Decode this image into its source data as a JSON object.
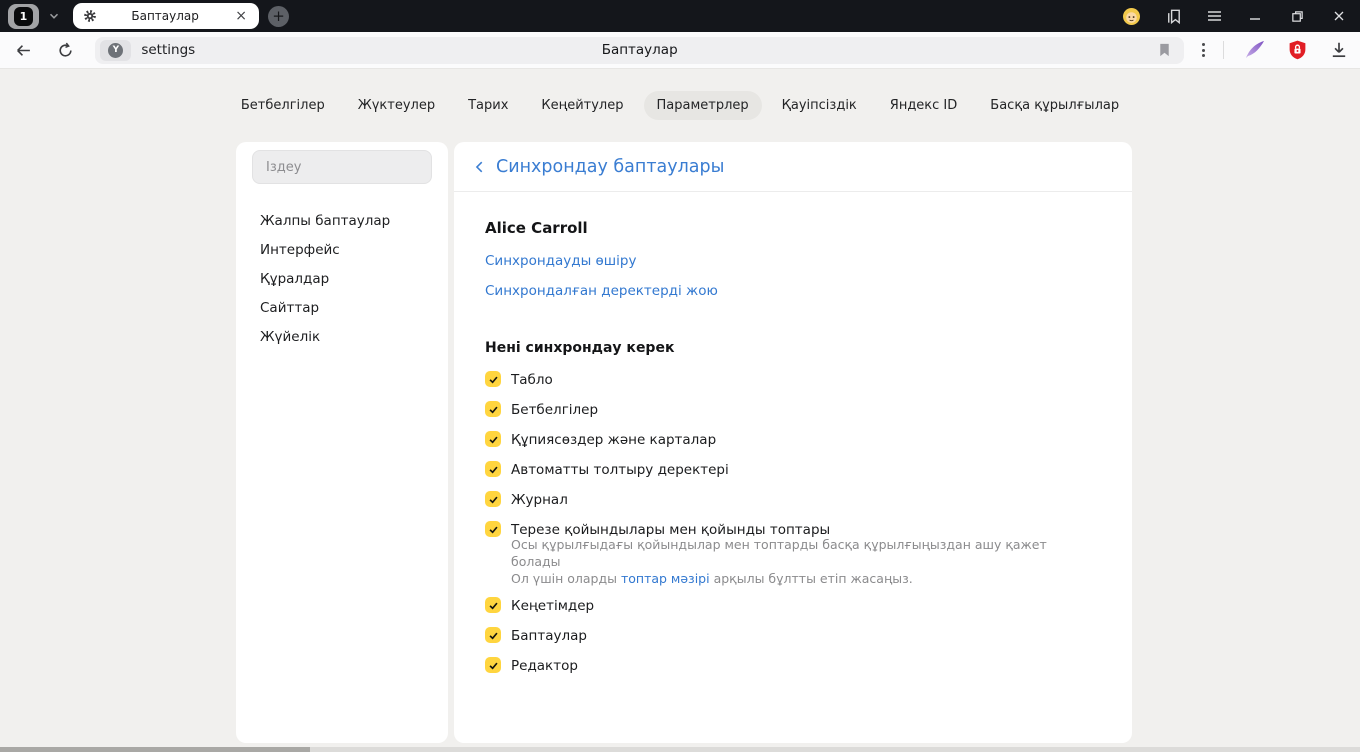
{
  "titlebar": {
    "tab_count": "1",
    "tab_title": "Баптаулар"
  },
  "toolbar": {
    "url": "settings",
    "page_title": "Баптаулар"
  },
  "nav": {
    "tabs": [
      {
        "label": "Бетбелгілер",
        "active": false
      },
      {
        "label": "Жүктеулер",
        "active": false
      },
      {
        "label": "Тарих",
        "active": false
      },
      {
        "label": "Кеңейтулер",
        "active": false
      },
      {
        "label": "Параметрлер",
        "active": true
      },
      {
        "label": "Қауіпсіздік",
        "active": false
      },
      {
        "label": "Яндекс ID",
        "active": false
      },
      {
        "label": "Басқа құрылғылар",
        "active": false
      }
    ]
  },
  "sidebar": {
    "search_placeholder": "Іздеу",
    "items": [
      {
        "label": "Жалпы баптаулар"
      },
      {
        "label": "Интерфейс"
      },
      {
        "label": "Құралдар"
      },
      {
        "label": "Сайттар"
      },
      {
        "label": "Жүйелік"
      }
    ]
  },
  "main": {
    "header_title": "Синхрондау баптаулары",
    "user_name": "Alice Carroll",
    "links": [
      {
        "label": "Синхрондауды өшіру"
      },
      {
        "label": "Синхрондалған деректерді жою"
      }
    ],
    "section_title": "Нені синхрондау керек",
    "checkboxes": [
      {
        "label": "Табло",
        "checked": true
      },
      {
        "label": "Бетбелгілер",
        "checked": true
      },
      {
        "label": "Құпиясөздер және карталар",
        "checked": true
      },
      {
        "label": "Автоматты толтыру деректері",
        "checked": true
      },
      {
        "label": "Журнал",
        "checked": true
      },
      {
        "label": "Терезе қойындылары мен қойынды топтары",
        "checked": true,
        "description_line1": "Осы құрылғыдағы қойындылар мен топтарды басқа құрылғыңыздан ашу қажет болады",
        "description_line2_prefix": "Ол үшін оларды ",
        "description_link": "топтар мәзірі",
        "description_line2_suffix": " арқылы бұлтты етіп жасаңыз."
      },
      {
        "label": "Кеңетімдер",
        "checked": true
      },
      {
        "label": "Баптаулар",
        "checked": true
      },
      {
        "label": "Редактор",
        "checked": true
      }
    ]
  },
  "colors": {
    "accent_blue": "#3a7dd2",
    "checkbox_yellow": "#ffd53f",
    "adblock_red": "#e11e25",
    "extension_purple": "#9a6fd0",
    "titlebar_dark": "#14161b"
  }
}
